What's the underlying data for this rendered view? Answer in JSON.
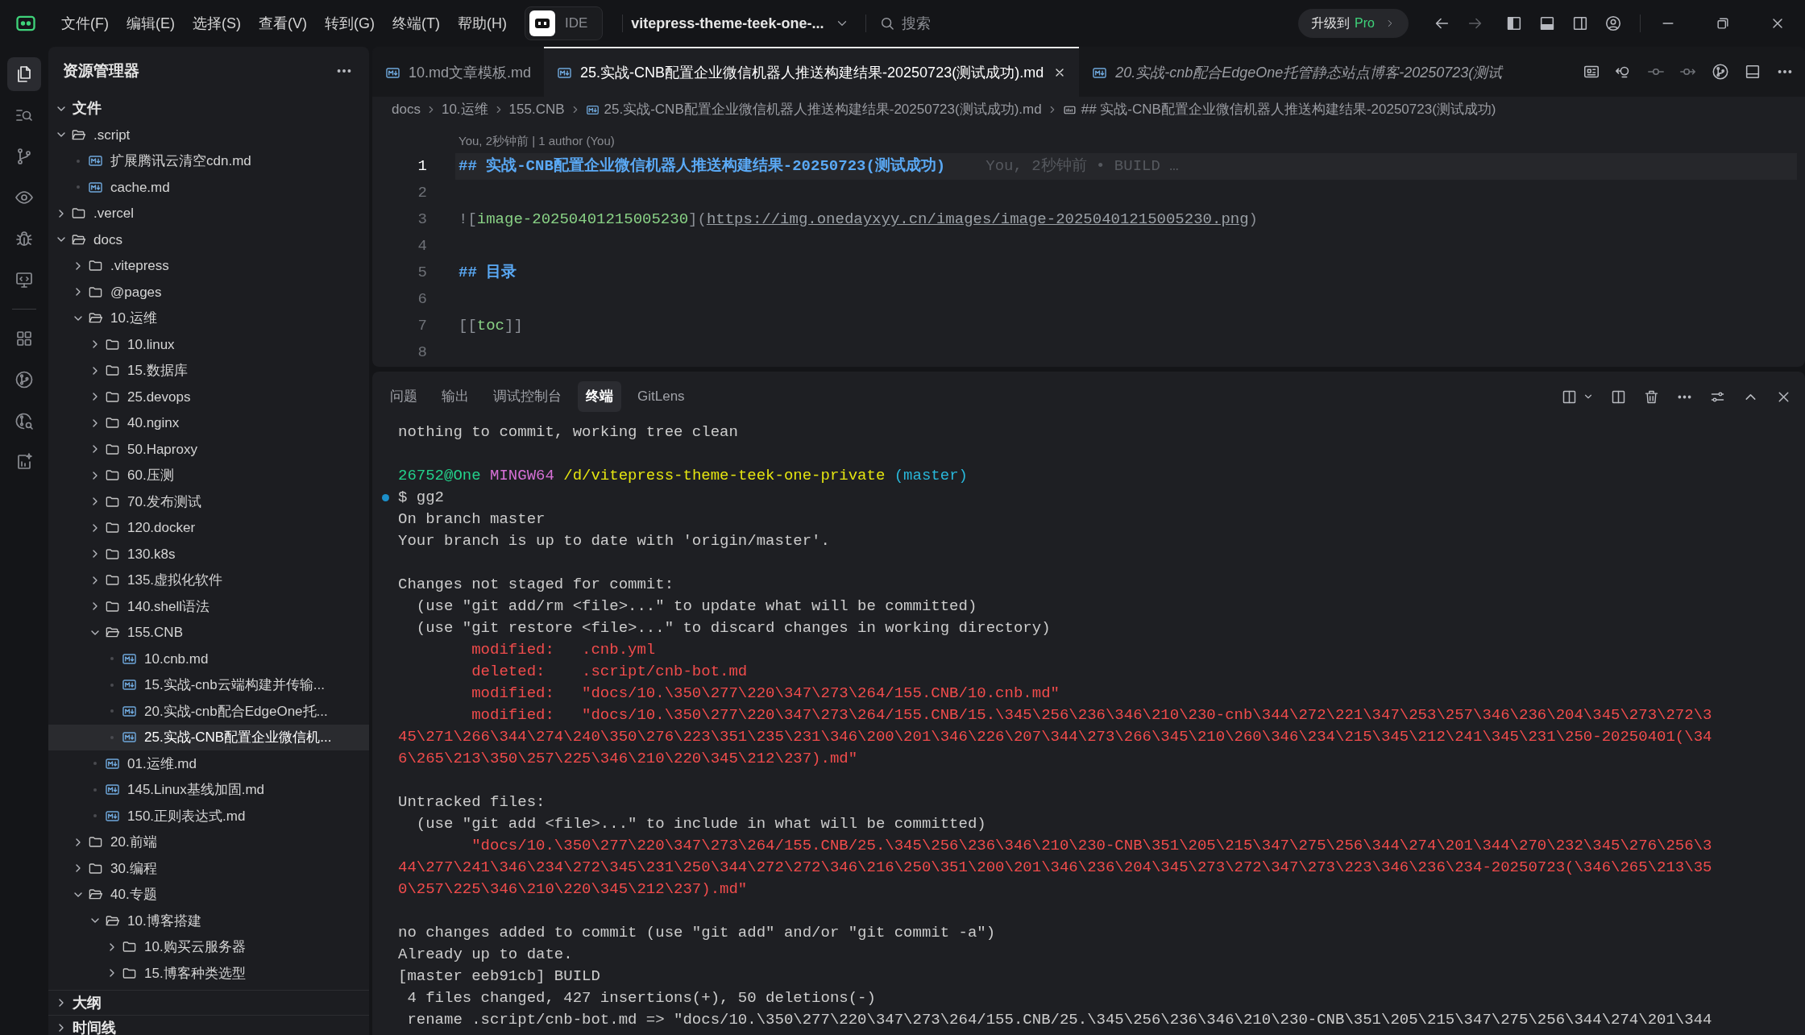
{
  "title_bar": {
    "menus": [
      "文件(F)",
      "编辑(E)",
      "选择(S)",
      "查看(V)",
      "转到(G)",
      "终端(T)",
      "帮助(H)"
    ],
    "mode": {
      "label": "IDE",
      "selected": false
    },
    "project": "vitepress-theme-teek-one-...",
    "search_placeholder": "搜索",
    "upgrade_label": "升级到",
    "upgrade_highlight": "Pro",
    "navigation": [
      {
        "kind": "back",
        "disabled": false
      },
      {
        "kind": "forward",
        "disabled": true
      }
    ]
  },
  "activity_bar": {
    "top": [
      {
        "kind": "explorer",
        "selected": true
      },
      {
        "kind": "search",
        "selected": false
      },
      {
        "kind": "source-control",
        "selected": false
      },
      {
        "kind": "eye",
        "selected": false
      },
      {
        "kind": "debug",
        "selected": false
      },
      {
        "kind": "remote",
        "selected": false
      }
    ],
    "bottom": [
      {
        "kind": "extensions",
        "selected": false
      },
      {
        "kind": "git-graph",
        "selected": false
      },
      {
        "kind": "git-search",
        "selected": false
      },
      {
        "kind": "ai",
        "selected": false
      }
    ]
  },
  "sidebar": {
    "title": "资源管理器",
    "section": {
      "label": "文件",
      "expanded": true
    },
    "tree": [
      {
        "label": ".script",
        "kind": "folder",
        "expanded": true,
        "selected": false,
        "children": [
          {
            "label": "扩展腾讯云清空cdn.md",
            "kind": "file",
            "selected": false
          },
          {
            "label": "cache.md",
            "kind": "file",
            "selected": false
          }
        ]
      },
      {
        "label": ".vercel",
        "kind": "folder",
        "expanded": false,
        "selected": false
      },
      {
        "label": "docs",
        "kind": "folder",
        "expanded": true,
        "selected": false,
        "children": [
          {
            "label": ".vitepress",
            "kind": "folder",
            "expanded": false,
            "selected": false
          },
          {
            "label": "@pages",
            "kind": "folder",
            "expanded": false,
            "selected": false
          },
          {
            "label": "10.运维",
            "kind": "folder",
            "expanded": true,
            "selected": false,
            "children": [
              {
                "label": "10.linux",
                "kind": "folder",
                "expanded": false,
                "selected": false
              },
              {
                "label": "15.数据库",
                "kind": "folder",
                "expanded": false,
                "selected": false
              },
              {
                "label": "25.devops",
                "kind": "folder",
                "expanded": false,
                "selected": false
              },
              {
                "label": "40.nginx",
                "kind": "folder",
                "expanded": false,
                "selected": false
              },
              {
                "label": "50.Haproxy",
                "kind": "folder",
                "expanded": false,
                "selected": false
              },
              {
                "label": "60.压测",
                "kind": "folder",
                "expanded": false,
                "selected": false
              },
              {
                "label": "70.发布测试",
                "kind": "folder",
                "expanded": false,
                "selected": false
              },
              {
                "label": "120.docker",
                "kind": "folder",
                "expanded": false,
                "selected": false
              },
              {
                "label": "130.k8s",
                "kind": "folder",
                "expanded": false,
                "selected": false
              },
              {
                "label": "135.虚拟化软件",
                "kind": "folder",
                "expanded": false,
                "selected": false
              },
              {
                "label": "140.shell语法",
                "kind": "folder",
                "expanded": false,
                "selected": false
              },
              {
                "label": "155.CNB",
                "kind": "folder",
                "expanded": true,
                "selected": false,
                "children": [
                  {
                    "label": "10.cnb.md",
                    "kind": "file",
                    "selected": false
                  },
                  {
                    "label": "15.实战-cnb云端构建并传输...",
                    "kind": "file",
                    "selected": false
                  },
                  {
                    "label": "20.实战-cnb配合EdgeOne托...",
                    "kind": "file",
                    "selected": false
                  },
                  {
                    "label": "25.实战-CNB配置企业微信机...",
                    "kind": "file",
                    "selected": true
                  }
                ]
              },
              {
                "label": "01.运维.md",
                "kind": "file",
                "selected": false
              },
              {
                "label": "145.Linux基线加固.md",
                "kind": "file",
                "selected": false
              },
              {
                "label": "150.正则表达式.md",
                "kind": "file",
                "selected": false
              }
            ]
          },
          {
            "label": "20.前端",
            "kind": "folder",
            "expanded": false,
            "selected": false
          },
          {
            "label": "30.编程",
            "kind": "folder",
            "expanded": false,
            "selected": false
          },
          {
            "label": "40.专题",
            "kind": "folder",
            "expanded": true,
            "selected": false,
            "children": [
              {
                "label": "10.博客搭建",
                "kind": "folder",
                "expanded": true,
                "selected": false,
                "children": [
                  {
                    "label": "10.购买云服务器",
                    "kind": "folder",
                    "expanded": false,
                    "selected": false
                  },
                  {
                    "label": "15.博客种类选型",
                    "kind": "folder",
                    "expanded": false,
                    "selected": false
                  }
                ]
              }
            ]
          }
        ]
      }
    ],
    "bottom_sections": [
      {
        "label": "大纲",
        "expanded": false
      },
      {
        "label": "时间线",
        "expanded": false
      }
    ]
  },
  "editor": {
    "tabs": [
      {
        "label": "10.md文章模板.md",
        "selected": false,
        "preview": false
      },
      {
        "label": "25.实战-CNB配置企业微信机器人推送构建结果-20250723(测试成功).md",
        "selected": true,
        "preview": false
      },
      {
        "label": "20.实战-cnb配合EdgeOne托管静态站点博客-20250723(测试",
        "selected": false,
        "preview": true
      }
    ],
    "breadcrumb": [
      {
        "label": "docs",
        "kind": "folder"
      },
      {
        "label": "10.运维",
        "kind": "folder"
      },
      {
        "label": "155.CNB",
        "kind": "folder"
      },
      {
        "label": "25.实战-CNB配置企业微信机器人推送构建结果-20250723(测试成功).md",
        "kind": "file"
      },
      {
        "label": "## 实战-CNB配置企业微信机器人推送构建结果-20250723(测试成功)",
        "kind": "heading"
      }
    ],
    "codelens": "You, 2秒钟前 | 1 author (You)",
    "lines": [
      {
        "number": "1",
        "current": true,
        "tokens": [
          {
            "text": "## 实战-CNB配置企业微信机器人推送构建结果-20250723(测试成功)",
            "kind": "heading"
          }
        ],
        "blame": "You, 2秒钟前 • BUILD …"
      },
      {
        "number": "2",
        "current": false
      },
      {
        "number": "3",
        "current": false,
        "tokens": [
          {
            "text": "![",
            "kind": "punct"
          },
          {
            "text": "image-20250401215005230",
            "kind": "link_text"
          },
          {
            "text": "](",
            "kind": "punct"
          },
          {
            "text": "https://img.onedayxyy.cn/images/image-20250401215005230.png",
            "kind": "url"
          },
          {
            "text": ")",
            "kind": "punct"
          }
        ]
      },
      {
        "number": "4",
        "current": false
      },
      {
        "number": "5",
        "current": false,
        "tokens": [
          {
            "text": "## 目录",
            "kind": "heading"
          }
        ]
      },
      {
        "number": "6",
        "current": false
      },
      {
        "number": "7",
        "current": false,
        "tokens": [
          {
            "text": "[[",
            "kind": "punct"
          },
          {
            "text": "toc",
            "kind": "link_text"
          },
          {
            "text": "]]",
            "kind": "punct"
          }
        ]
      },
      {
        "number": "8",
        "current": false
      }
    ]
  },
  "panel": {
    "tabs": [
      {
        "label": "问题",
        "selected": false
      },
      {
        "label": "输出",
        "selected": false
      },
      {
        "label": "调试控制台",
        "selected": false
      },
      {
        "label": "终端",
        "selected": true
      },
      {
        "label": "GitLens",
        "selected": false
      }
    ],
    "terminal": [
      {
        "kind": "output",
        "segments": [
          {
            "text": "nothing to commit, working tree clean",
            "kind": "plain"
          }
        ]
      },
      {
        "kind": "blank"
      },
      {
        "kind": "output",
        "segments": [
          {
            "text": "26752@One ",
            "kind": "user"
          },
          {
            "text": "MINGW64 ",
            "kind": "host"
          },
          {
            "text": "/d/vitepress-theme-teek-one-private ",
            "kind": "path"
          },
          {
            "text": "(master)",
            "kind": "branch"
          }
        ]
      },
      {
        "kind": "command",
        "segments": [
          {
            "text": "$ gg2",
            "kind": "plain"
          }
        ]
      },
      {
        "kind": "output",
        "segments": [
          {
            "text": "On branch master",
            "kind": "plain"
          }
        ]
      },
      {
        "kind": "output",
        "segments": [
          {
            "text": "Your branch is up to date with 'origin/master'.",
            "kind": "plain"
          }
        ]
      },
      {
        "kind": "blank"
      },
      {
        "kind": "output",
        "segments": [
          {
            "text": "Changes not staged for commit:",
            "kind": "plain"
          }
        ]
      },
      {
        "kind": "output",
        "segments": [
          {
            "text": "  (use \"git add/rm <file>...\" to update what will be committed)",
            "kind": "plain"
          }
        ]
      },
      {
        "kind": "output",
        "segments": [
          {
            "text": "  (use \"git restore <file>...\" to discard changes in working directory)",
            "kind": "plain"
          }
        ]
      },
      {
        "kind": "output",
        "segments": [
          {
            "text": "        modified:   .cnb.yml",
            "kind": "error"
          }
        ]
      },
      {
        "kind": "output",
        "segments": [
          {
            "text": "        deleted:    .script/cnb-bot.md",
            "kind": "error"
          }
        ]
      },
      {
        "kind": "output",
        "segments": [
          {
            "text": "        modified:   \"docs/10.\\350\\277\\220\\347\\273\\264/155.CNB/10.cnb.md\"",
            "kind": "error"
          }
        ]
      },
      {
        "kind": "output",
        "segments": [
          {
            "text": "        modified:   \"docs/10.\\350\\277\\220\\347\\273\\264/155.CNB/15.\\345\\256\\236\\346\\210\\230-cnb\\344\\272\\221\\347\\253\\257\\346\\236\\204\\345\\273\\272\\3",
            "kind": "error"
          }
        ]
      },
      {
        "kind": "output",
        "segments": [
          {
            "text": "45\\271\\266\\344\\274\\240\\350\\276\\223\\351\\235\\231\\346\\200\\201\\346\\226\\207\\344\\273\\266\\345\\210\\260\\346\\234\\215\\345\\212\\241\\345\\231\\250-20250401(\\34",
            "kind": "error"
          }
        ]
      },
      {
        "kind": "output",
        "segments": [
          {
            "text": "6\\265\\213\\350\\257\\225\\346\\210\\220\\345\\212\\237).md\"",
            "kind": "error"
          }
        ]
      },
      {
        "kind": "blank"
      },
      {
        "kind": "output",
        "segments": [
          {
            "text": "Untracked files:",
            "kind": "plain"
          }
        ]
      },
      {
        "kind": "output",
        "segments": [
          {
            "text": "  (use \"git add <file>...\" to include in what will be committed)",
            "kind": "plain"
          }
        ]
      },
      {
        "kind": "output",
        "segments": [
          {
            "text": "        \"docs/10.\\350\\277\\220\\347\\273\\264/155.CNB/25.\\345\\256\\236\\346\\210\\230-CNB\\351\\205\\215\\347\\275\\256\\344\\274\\201\\344\\270\\232\\345\\276\\256\\3",
            "kind": "error"
          }
        ]
      },
      {
        "kind": "output",
        "segments": [
          {
            "text": "44\\277\\241\\346\\234\\272\\345\\231\\250\\344\\272\\272\\346\\216\\250\\351\\200\\201\\346\\236\\204\\345\\273\\272\\347\\273\\223\\346\\236\\234-20250723(\\346\\265\\213\\35",
            "kind": "error"
          }
        ]
      },
      {
        "kind": "output",
        "segments": [
          {
            "text": "0\\257\\225\\346\\210\\220\\345\\212\\237).md\"",
            "kind": "error"
          }
        ]
      },
      {
        "kind": "blank"
      },
      {
        "kind": "output",
        "segments": [
          {
            "text": "no changes added to commit (use \"git add\" and/or \"git commit -a\")",
            "kind": "plain"
          }
        ]
      },
      {
        "kind": "output",
        "segments": [
          {
            "text": "Already up to date.",
            "kind": "plain"
          }
        ]
      },
      {
        "kind": "output",
        "segments": [
          {
            "text": "[master eeb91cb] BUILD",
            "kind": "plain"
          }
        ]
      },
      {
        "kind": "output",
        "segments": [
          {
            "text": " 4 files changed, 427 insertions(+), 50 deletions(-)",
            "kind": "plain"
          }
        ]
      },
      {
        "kind": "output",
        "segments": [
          {
            "text": " rename .script/cnb-bot.md => \"docs/10.\\350\\277\\220\\347\\273\\264/155.CNB/25.\\345\\256\\236\\346\\210\\230-CNB\\351\\205\\215\\347\\275\\256\\344\\274\\201\\344",
            "kind": "plain"
          }
        ]
      }
    ]
  }
}
